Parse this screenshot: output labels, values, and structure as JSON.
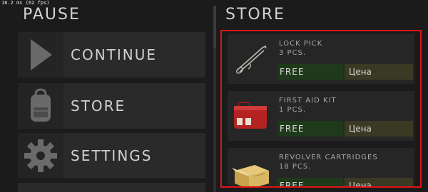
{
  "debug": {
    "fps_text": "16.2 ms (62 fps)"
  },
  "pause_panel": {
    "title": "PAUSE",
    "buttons": [
      {
        "label": "CONTINUE",
        "icon": "play-icon"
      },
      {
        "label": "STORE",
        "icon": "backpack-icon"
      },
      {
        "label": "SETTINGS",
        "icon": "gear-icon"
      }
    ]
  },
  "store_panel": {
    "title": "STORE",
    "items": [
      {
        "name": "LOCK PICK",
        "qty": "3 PCS.",
        "free_label": "FREE",
        "price_label": "Цена",
        "icon": "lock-pick-icon"
      },
      {
        "name": "FIRST AID KIT",
        "qty": "1 PCS.",
        "free_label": "FREE",
        "price_label": "Цена",
        "icon": "first-aid-kit-icon"
      },
      {
        "name": "REVOLVER CARTRIDGES",
        "qty": "18 PCS.",
        "free_label": "FREE",
        "price_label": "Цена",
        "icon": "ammo-box-icon"
      }
    ]
  },
  "colors": {
    "background": "#1b1b1b",
    "button_bg": "#2a2a2a",
    "free_button": "#1f3a1a",
    "price_button": "#3a3a24",
    "highlight_border": "#e01414"
  }
}
